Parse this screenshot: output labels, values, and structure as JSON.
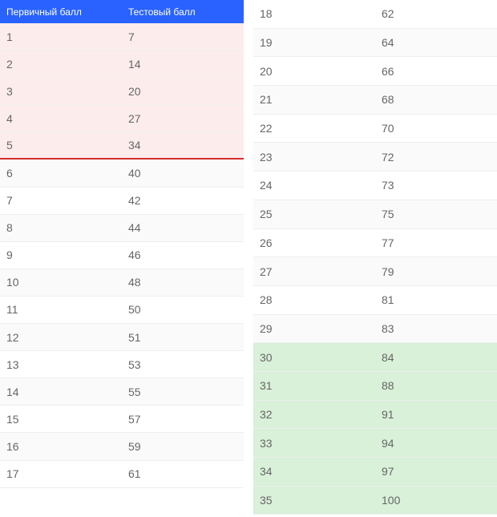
{
  "headers": {
    "primary": "Первичный балл",
    "test": "Тестовый балл"
  },
  "left_rows": [
    {
      "primary": "1",
      "test": "7",
      "class": "pink"
    },
    {
      "primary": "2",
      "test": "14",
      "class": "pink"
    },
    {
      "primary": "3",
      "test": "20",
      "class": "pink"
    },
    {
      "primary": "4",
      "test": "27",
      "class": "pink"
    },
    {
      "primary": "5",
      "test": "34",
      "class": "pink red-border"
    },
    {
      "primary": "6",
      "test": "40",
      "class": "plain"
    },
    {
      "primary": "7",
      "test": "42",
      "class": "plain"
    },
    {
      "primary": "8",
      "test": "44",
      "class": "plain"
    },
    {
      "primary": "9",
      "test": "46",
      "class": "plain"
    },
    {
      "primary": "10",
      "test": "48",
      "class": "plain"
    },
    {
      "primary": "11",
      "test": "50",
      "class": "plain"
    },
    {
      "primary": "12",
      "test": "51",
      "class": "plain"
    },
    {
      "primary": "13",
      "test": "53",
      "class": "plain"
    },
    {
      "primary": "14",
      "test": "55",
      "class": "plain"
    },
    {
      "primary": "15",
      "test": "57",
      "class": "plain"
    },
    {
      "primary": "16",
      "test": "59",
      "class": "plain"
    },
    {
      "primary": "17",
      "test": "61",
      "class": "plain"
    }
  ],
  "right_rows": [
    {
      "primary": "18",
      "test": "62",
      "class": "plain"
    },
    {
      "primary": "19",
      "test": "64",
      "class": "plain"
    },
    {
      "primary": "20",
      "test": "66",
      "class": "plain"
    },
    {
      "primary": "21",
      "test": "68",
      "class": "plain"
    },
    {
      "primary": "22",
      "test": "70",
      "class": "plain"
    },
    {
      "primary": "23",
      "test": "72",
      "class": "plain"
    },
    {
      "primary": "24",
      "test": "73",
      "class": "plain"
    },
    {
      "primary": "25",
      "test": "75",
      "class": "plain"
    },
    {
      "primary": "26",
      "test": "77",
      "class": "plain"
    },
    {
      "primary": "27",
      "test": "79",
      "class": "plain"
    },
    {
      "primary": "28",
      "test": "81",
      "class": "plain"
    },
    {
      "primary": "29",
      "test": "83",
      "class": "plain"
    },
    {
      "primary": "30",
      "test": "84",
      "class": "green"
    },
    {
      "primary": "31",
      "test": "88",
      "class": "green"
    },
    {
      "primary": "32",
      "test": "91",
      "class": "green"
    },
    {
      "primary": "33",
      "test": "94",
      "class": "green"
    },
    {
      "primary": "34",
      "test": "97",
      "class": "green"
    },
    {
      "primary": "35",
      "test": "100",
      "class": "green"
    }
  ]
}
